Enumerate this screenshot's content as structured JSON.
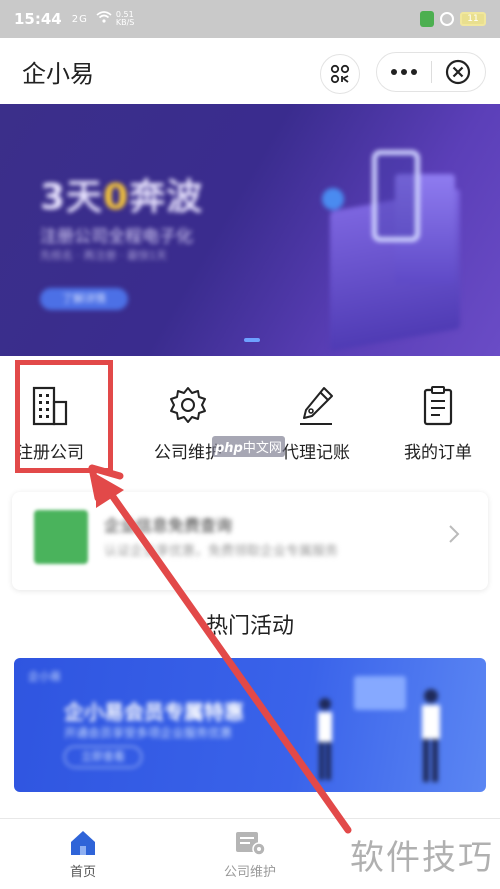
{
  "status_bar": {
    "time": "15:44",
    "signal": "2G",
    "speed": "0.51 KB/S",
    "battery": "11"
  },
  "header": {
    "title": "企小易"
  },
  "banner": {
    "headline_pre": "3天",
    "headline_zero": "0",
    "headline_post": "奔波",
    "subtitle": "注册公司全程电子化",
    "desc": "先核名 · 再注册 · 最快1天",
    "cta": "了解详情"
  },
  "menu": {
    "items": [
      {
        "label": "注册公司",
        "icon": "building-icon"
      },
      {
        "label": "公司维护",
        "icon": "gear-icon"
      },
      {
        "label": "代理记账",
        "icon": "pen-icon"
      },
      {
        "label": "我的订单",
        "icon": "clipboard-icon"
      }
    ]
  },
  "promo": {
    "title": "企业信息免费查询",
    "subtitle": "认证企业享优惠，免费领取企业专属服务"
  },
  "section": {
    "title": "热门活动"
  },
  "activity": {
    "badge": "企小易",
    "title": "企小易会员专属特惠",
    "subtitle": "开通会员享受多项企业服务优惠",
    "button": "立即查看"
  },
  "tabbar": {
    "home": "首页",
    "maintenance": "公司维护"
  },
  "watermarks": {
    "php": "php",
    "php_suffix": "中文网",
    "tips": "软件技巧"
  },
  "colors": {
    "highlight": "#e24949",
    "banner_bg": "#3b2f8a",
    "activity_bg": "#2f55e0",
    "home_tab": "#2f64d8"
  }
}
